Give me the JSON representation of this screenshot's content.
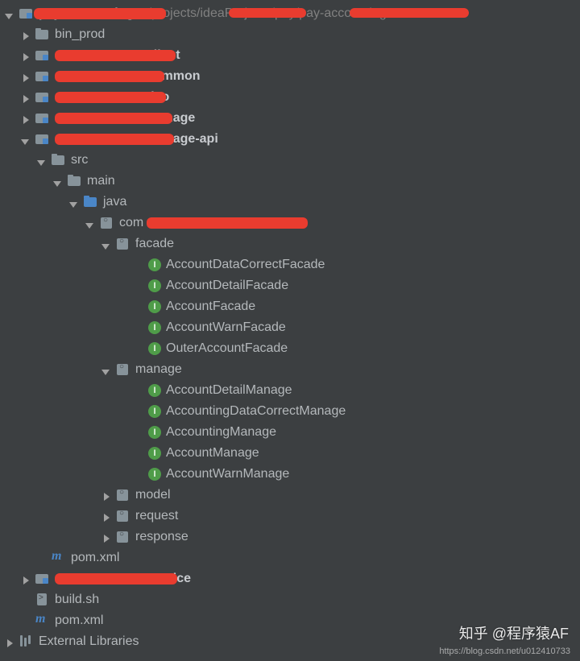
{
  "root": {
    "name": "pay-accounting",
    "path": "~/projects/ideaProjects/pay/pay-accounting"
  },
  "modules": {
    "bin_prod": "bin_prod",
    "client_suffix": "-client",
    "common_suffix": "-common",
    "dao_suffix": "-dao",
    "manage_suffix": "-manage",
    "manage_api_suffix": "-manage-api",
    "service_suffix": "-service"
  },
  "src": {
    "src": "src",
    "main": "main",
    "java": "java",
    "com_prefix": "com",
    "facade": "facade",
    "manage": "manage",
    "model": "model",
    "request": "request",
    "response": "response"
  },
  "facade_classes": [
    "AccountDataCorrectFacade",
    "AccountDetailFacade",
    "AccountFacade",
    "AccountWarnFacade",
    "OuterAccountFacade"
  ],
  "manage_classes": [
    "AccountDetailManage",
    "AccountingDataCorrectManage",
    "AccountingManage",
    "AccountManage",
    "AccountWarnManage"
  ],
  "files": {
    "pom_xml": "pom.xml",
    "build_sh": "build.sh",
    "external_libs": "External Libraries"
  },
  "watermark": {
    "zhihu": "知乎 @程序猿AF",
    "csdn": "https://blog.csdn.net/u012410733"
  }
}
